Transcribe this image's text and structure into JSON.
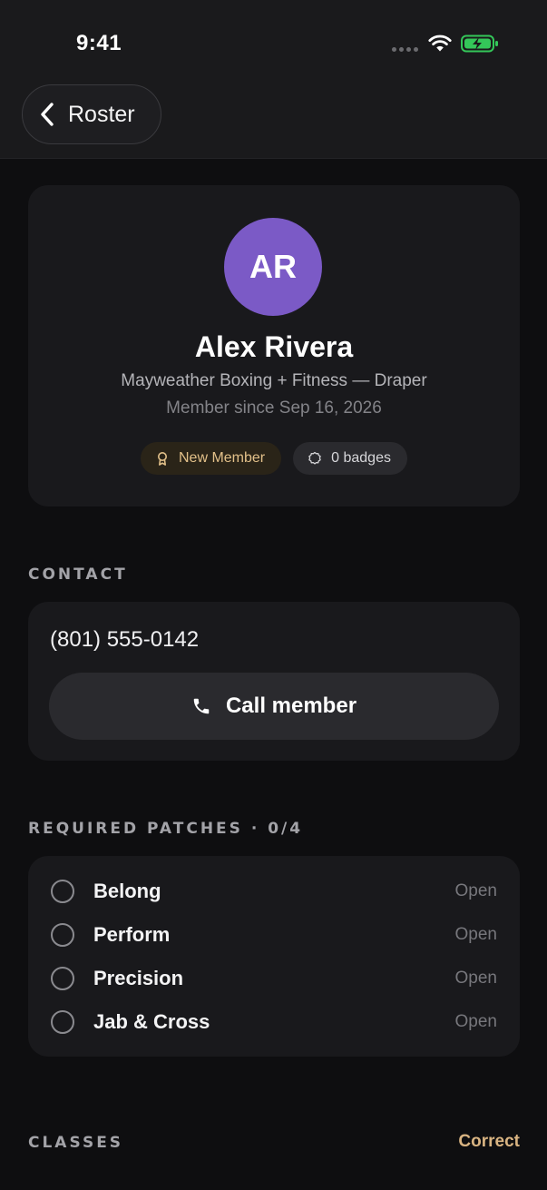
{
  "status_bar": {
    "time": "9:41"
  },
  "nav": {
    "back_label": "Roster"
  },
  "profile": {
    "initials": "AR",
    "avatar_color": "#7b5ac6",
    "name": "Alex Rivera",
    "gym": "Mayweather Boxing + Fitness — Draper",
    "member_since": "Member since Sep 16, 2026",
    "badges": [
      {
        "label": "New Member",
        "icon": "award-ribbon-icon"
      },
      {
        "label": "0 badges",
        "icon": "badge-outline-icon"
      }
    ]
  },
  "contact": {
    "section_label": "CONTACT",
    "phone": "(801) 555-0142",
    "call_label": "Call member",
    "call_icon": "phone-icon"
  },
  "patches": {
    "section_label": "REQUIRED PATCHES · 0/4",
    "items": [
      {
        "name": "Belong",
        "status": "Open"
      },
      {
        "name": "Perform",
        "status": "Open"
      },
      {
        "name": "Precision",
        "status": "Open"
      },
      {
        "name": "Jab & Cross",
        "status": "Open"
      }
    ]
  },
  "classes": {
    "section_label": "CLASSES",
    "action_label": "Correct",
    "accent": "#d9b482"
  }
}
